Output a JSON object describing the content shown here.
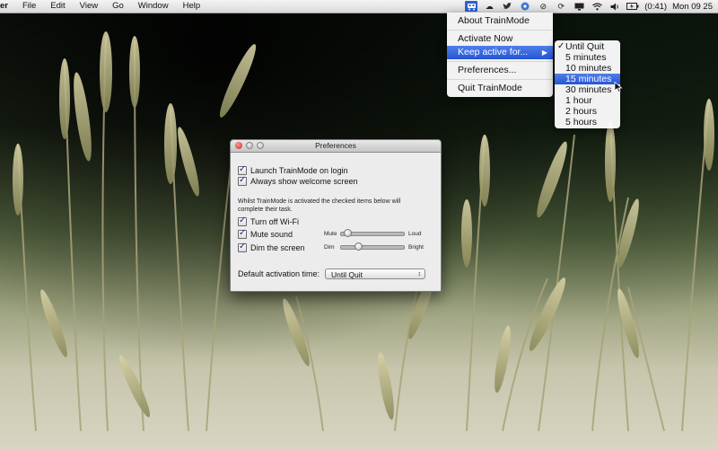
{
  "menubar": {
    "app_name": "er",
    "items": [
      "File",
      "Edit",
      "View",
      "Go",
      "Window",
      "Help"
    ],
    "battery": "(0:41)",
    "clock": "Mon 09 25",
    "status_icons": [
      "trainmode-icon",
      "cloud-icon",
      "twitter-icon",
      "dropbox-icon",
      "sync-icon",
      "timemachine-icon",
      "display-icon",
      "wifi-icon",
      "volume-icon",
      "battery-icon"
    ]
  },
  "trainmode_menu": {
    "about": "About TrainMode",
    "activate": "Activate Now",
    "keep_active": "Keep active for...",
    "preferences": "Preferences...",
    "quit": "Quit TrainMode"
  },
  "keep_active_submenu": {
    "options": [
      "Until Quit",
      "5 minutes",
      "10 minutes",
      "15 minutes",
      "30 minutes",
      "1 hour",
      "2 hours",
      "5 hours"
    ],
    "checked": "Until Quit",
    "highlighted": "15 minutes"
  },
  "preferences": {
    "title": "Preferences",
    "launch_on_login": "Launch TrainMode on login",
    "show_welcome": "Always show welcome screen",
    "note": "Whilst TrainMode is activated the checked items below will complete their task.",
    "wifi": "Turn off Wi-Fi",
    "mute": "Mute sound",
    "mute_min": "Mute",
    "mute_max": "Loud",
    "mute_level": 0.05,
    "dim": "Dim the screen",
    "dim_min": "Dim",
    "dim_max": "Bright",
    "dim_level": 0.25,
    "default_label": "Default activation time:",
    "default_value": "Until Quit"
  },
  "colors": {
    "highlight": "#2456d6",
    "menubar": "#e6e6e6"
  }
}
